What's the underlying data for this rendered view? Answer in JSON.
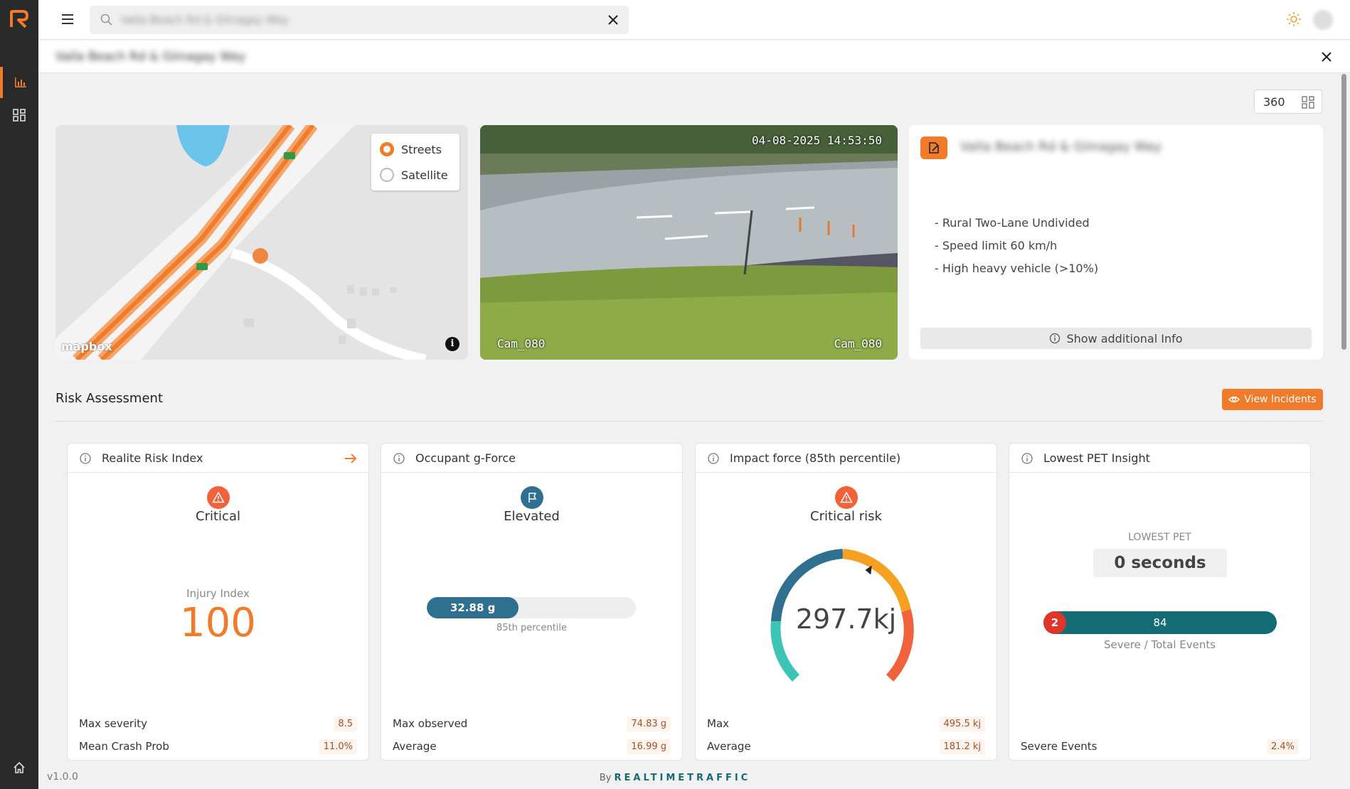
{
  "app": {
    "version": "v1.0.0",
    "footer_by": "By",
    "footer_brand": "REALTIMETRAFFIC",
    "accent": "#f07b2a",
    "teal": "#136b73"
  },
  "topbar": {
    "search_value": "Valla Beach Rd & Giinagay Way",
    "icons": [
      "menu-icon",
      "search-icon",
      "close-icon",
      "sun-icon"
    ]
  },
  "subbar": {
    "title": "Valla Beach Rd & Giinagay Way"
  },
  "toolbar": {
    "view_360_label": "360"
  },
  "map": {
    "options": [
      {
        "label": "Streets",
        "selected": true
      },
      {
        "label": "Satellite",
        "selected": false
      }
    ],
    "attribution": "mapbox",
    "info_glyph": "i"
  },
  "camera": {
    "timestamp": "04-08-2025 14:53:50",
    "label_left": "Cam_080",
    "label_right": "Cam_080"
  },
  "location": {
    "title": "Valla Beach Rd & Giinagay Way",
    "features": [
      "- Rural Two-Lane Undivided",
      "- Speed limit 60 km/h",
      "- High heavy vehicle (>10%)"
    ],
    "more_button": "Show additional Info"
  },
  "risk": {
    "section_title": "Risk Assessment",
    "view_incidents": "View Incidents",
    "cards": {
      "risk_index": {
        "title": "Realite Risk Index",
        "status": "Critical",
        "injury_label": "Injury Index",
        "injury_value": "100",
        "rows": [
          {
            "label": "Max severity",
            "value": "8.5"
          },
          {
            "label": "Mean Crash Prob",
            "value": "11.0%"
          }
        ]
      },
      "gforce": {
        "title": "Occupant g-Force",
        "status": "Elevated",
        "bar_label": "32.88 g",
        "bar_fraction": 0.44,
        "caption": "85th percentile",
        "rows": [
          {
            "label": "Max observed",
            "value": "74.83 g"
          },
          {
            "label": "Average",
            "value": "16.99 g"
          }
        ]
      },
      "impact": {
        "title": "Impact force (85th percentile)",
        "status": "Critical risk",
        "gauge_value": "297.7kj",
        "gauge_fraction": 0.6,
        "rows": [
          {
            "label": "Max",
            "value": "495.5 kj"
          },
          {
            "label": "Average",
            "value": "181.2 kj"
          }
        ]
      },
      "pet": {
        "title": "Lowest PET Insight",
        "lowest_label": "LOWEST PET",
        "lowest_value": "0 seconds",
        "severe_count": "2",
        "total_count": "84",
        "caption": "Severe / Total Events",
        "rows": [
          {
            "label": "Severe Events",
            "value": "2.4%"
          }
        ]
      }
    }
  }
}
